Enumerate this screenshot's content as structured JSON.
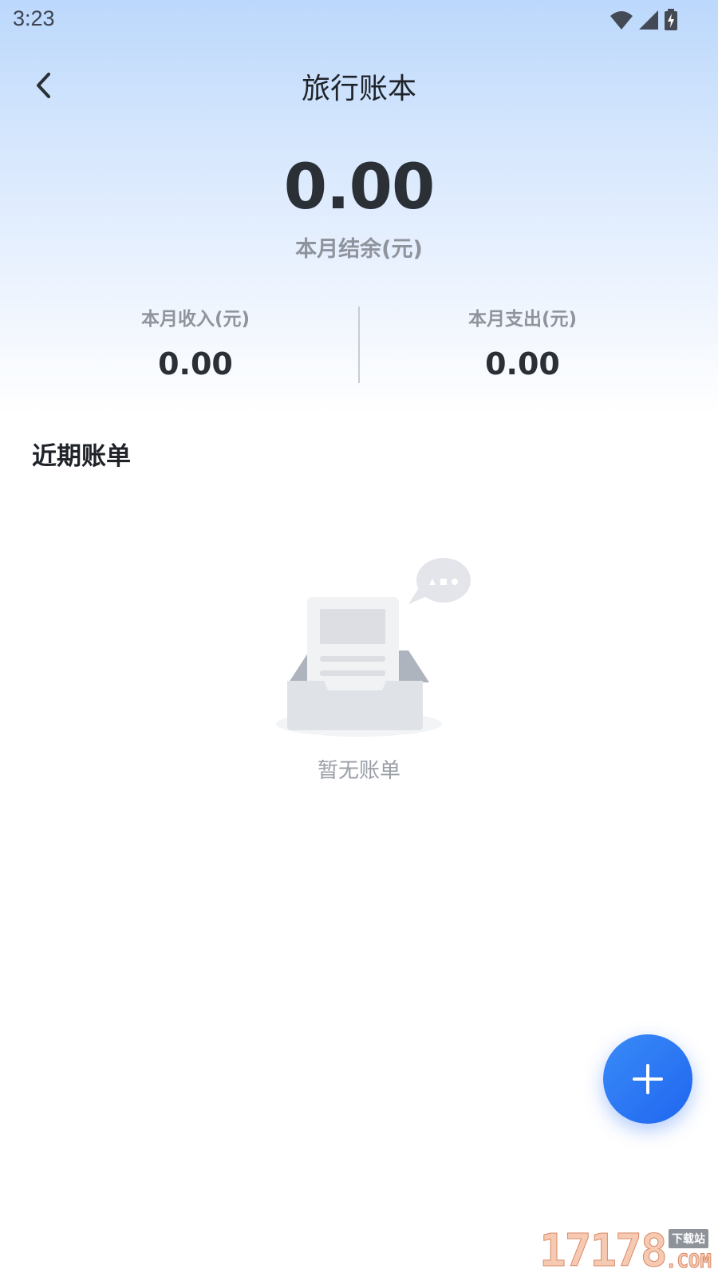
{
  "status_bar": {
    "time": "3:23",
    "icons": [
      "wifi-icon",
      "signal-icon",
      "battery-charging-icon"
    ]
  },
  "nav": {
    "back_icon": "chevron-left-icon",
    "title": "旅行账本"
  },
  "summary": {
    "balance_amount": "0.00",
    "balance_label": "本月结余(元)",
    "income_label": "本月收入(元)",
    "income_value": "0.00",
    "expense_label": "本月支出(元)",
    "expense_value": "0.00"
  },
  "recent": {
    "title": "近期账单",
    "empty_icon": "empty-inbox-icon",
    "empty_text": "暂无账单"
  },
  "fab": {
    "icon": "plus-icon"
  },
  "watermark": {
    "digits": "17178",
    "badge": "下载站",
    "suffix": ".COM"
  },
  "colors": {
    "header_gradient_top": "#bcd8fc",
    "accent": "#1f66f0",
    "text_primary": "#2b2f36",
    "text_secondary": "#8f939b"
  }
}
